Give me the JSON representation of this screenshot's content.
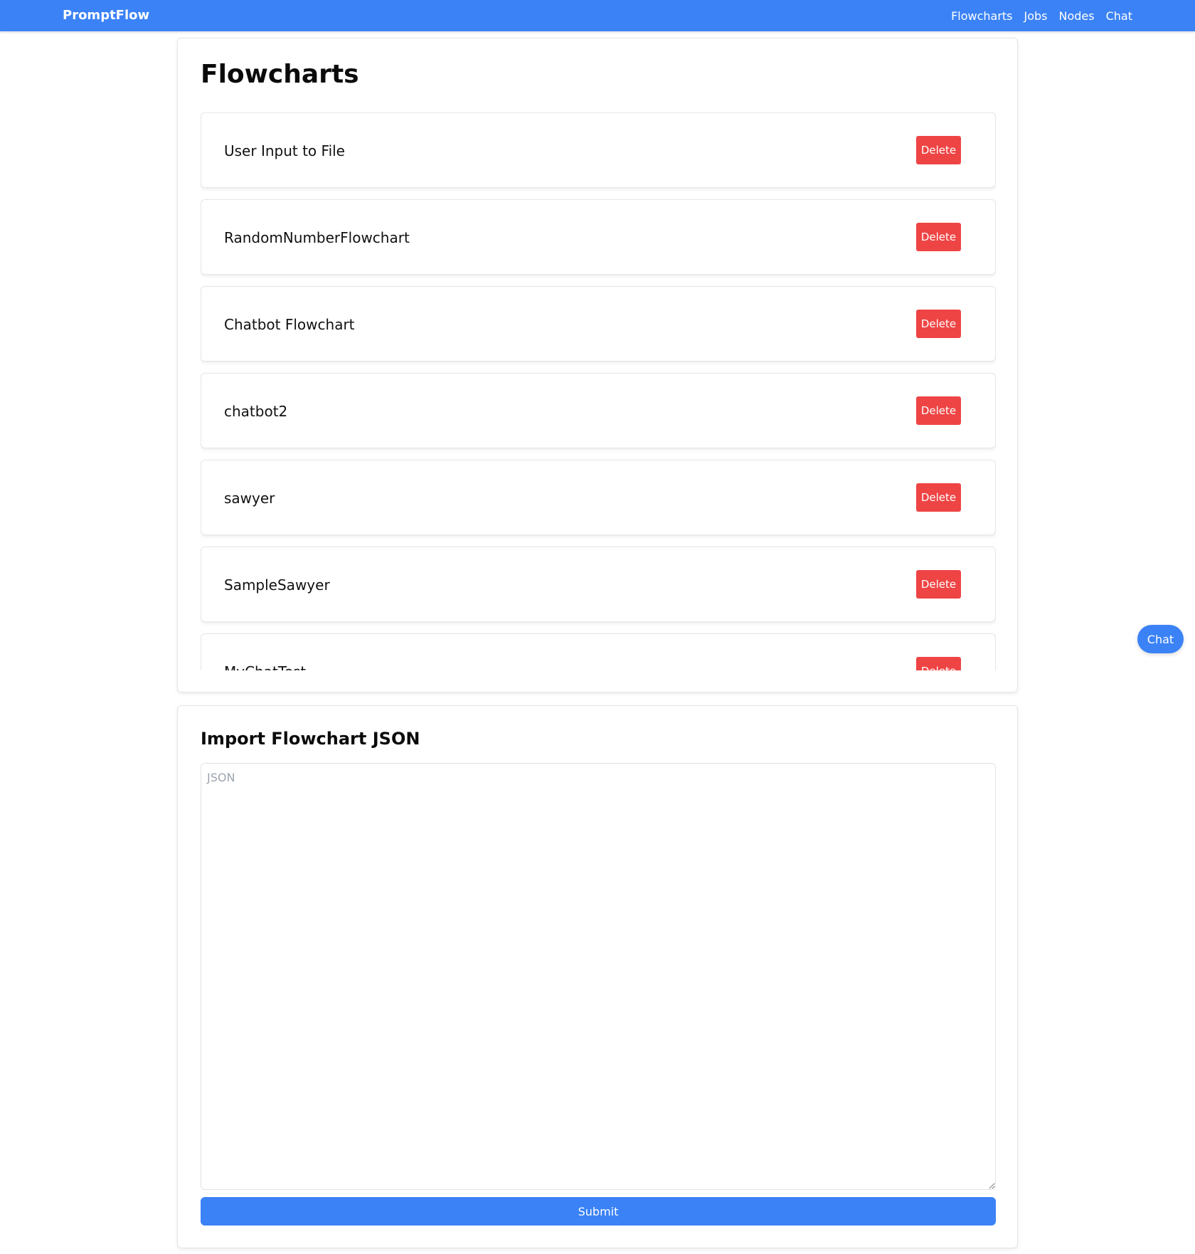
{
  "navbar": {
    "brand": "PromptFlow",
    "links": [
      "Flowcharts",
      "Jobs",
      "Nodes",
      "Chat"
    ]
  },
  "flowcharts": {
    "title": "Flowcharts",
    "delete_label": "Delete",
    "items": [
      {
        "name": "User Input to File"
      },
      {
        "name": "RandomNumberFlowchart"
      },
      {
        "name": "Chatbot Flowchart"
      },
      {
        "name": "chatbot2"
      },
      {
        "name": "sawyer"
      },
      {
        "name": "SampleSawyer"
      },
      {
        "name": "MyChatTest"
      }
    ]
  },
  "import": {
    "title": "Import Flowchart JSON",
    "placeholder": "JSON",
    "value": "",
    "submit_label": "Submit"
  },
  "chat_fab": {
    "label": "Chat"
  },
  "colors": {
    "primary": "#3b82f6",
    "danger": "#ef4444"
  }
}
